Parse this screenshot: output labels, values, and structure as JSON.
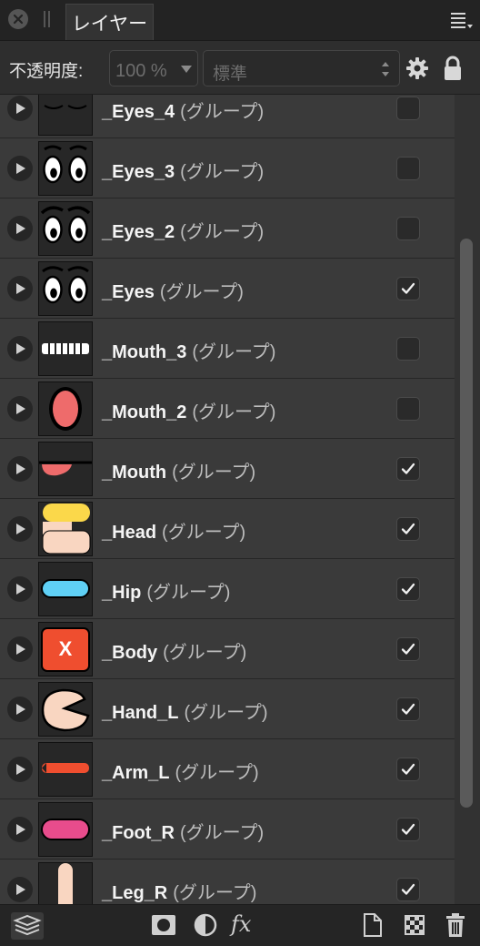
{
  "panel": {
    "tab_label": "レイヤー"
  },
  "options": {
    "opacity_label": "不透明度:",
    "opacity_value": "100 %",
    "blend_mode": "標準"
  },
  "layers": [
    {
      "name": "_Eyes_4",
      "kind": "(グループ)",
      "visible": false,
      "thumbnail": "eyes-closed"
    },
    {
      "name": "_Eyes_3",
      "kind": "(グループ)",
      "visible": false,
      "thumbnail": "eyes-open-raised"
    },
    {
      "name": "_Eyes_2",
      "kind": "(グループ)",
      "visible": false,
      "thumbnail": "eyes-open-lashes"
    },
    {
      "name": "_Eyes",
      "kind": "(グループ)",
      "visible": true,
      "thumbnail": "eyes-open"
    },
    {
      "name": "_Mouth_3",
      "kind": "(グループ)",
      "visible": false,
      "thumbnail": "mouth-teeth"
    },
    {
      "name": "_Mouth_2",
      "kind": "(グループ)",
      "visible": false,
      "thumbnail": "mouth-oval"
    },
    {
      "name": "_Mouth",
      "kind": "(グループ)",
      "visible": true,
      "thumbnail": "mouth-tongue"
    },
    {
      "name": "_Head",
      "kind": "(グループ)",
      "visible": true,
      "thumbnail": "head"
    },
    {
      "name": "_Hip",
      "kind": "(グループ)",
      "visible": true,
      "thumbnail": "hip"
    },
    {
      "name": "_Body",
      "kind": "(グループ)",
      "visible": true,
      "thumbnail": "body-x"
    },
    {
      "name": "_Hand_L",
      "kind": "(グループ)",
      "visible": true,
      "thumbnail": "hand"
    },
    {
      "name": "_Arm_L",
      "kind": "(グループ)",
      "visible": true,
      "thumbnail": "arm"
    },
    {
      "name": "_Foot_R",
      "kind": "(グループ)",
      "visible": true,
      "thumbnail": "foot"
    },
    {
      "name": "_Leg_R",
      "kind": "(グループ)",
      "visible": true,
      "thumbnail": "leg"
    }
  ],
  "thumb_text": {
    "body_mark": "X"
  },
  "colors": {
    "mouth_red": "#ee6b6b",
    "head_yellow": "#fbd84a",
    "skin": "#f9d6c1",
    "hip_blue": "#5fd0f5",
    "body_orange": "#ef4e2f",
    "foot_pink": "#e84c8c"
  }
}
